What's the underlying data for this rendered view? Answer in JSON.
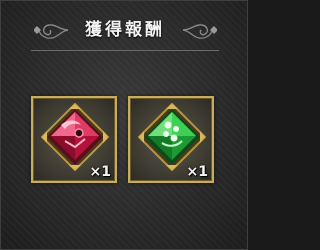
{
  "header": {
    "title": "獲得報酬"
  },
  "rewards": [
    {
      "icon": "red-gem-icon",
      "quantity": "×1",
      "color": "#c8163a"
    },
    {
      "icon": "green-gem-icon",
      "quantity": "×1",
      "color": "#22b23a"
    }
  ],
  "colors": {
    "frame": "#c9ad5f",
    "background": "#2b2b2b"
  }
}
